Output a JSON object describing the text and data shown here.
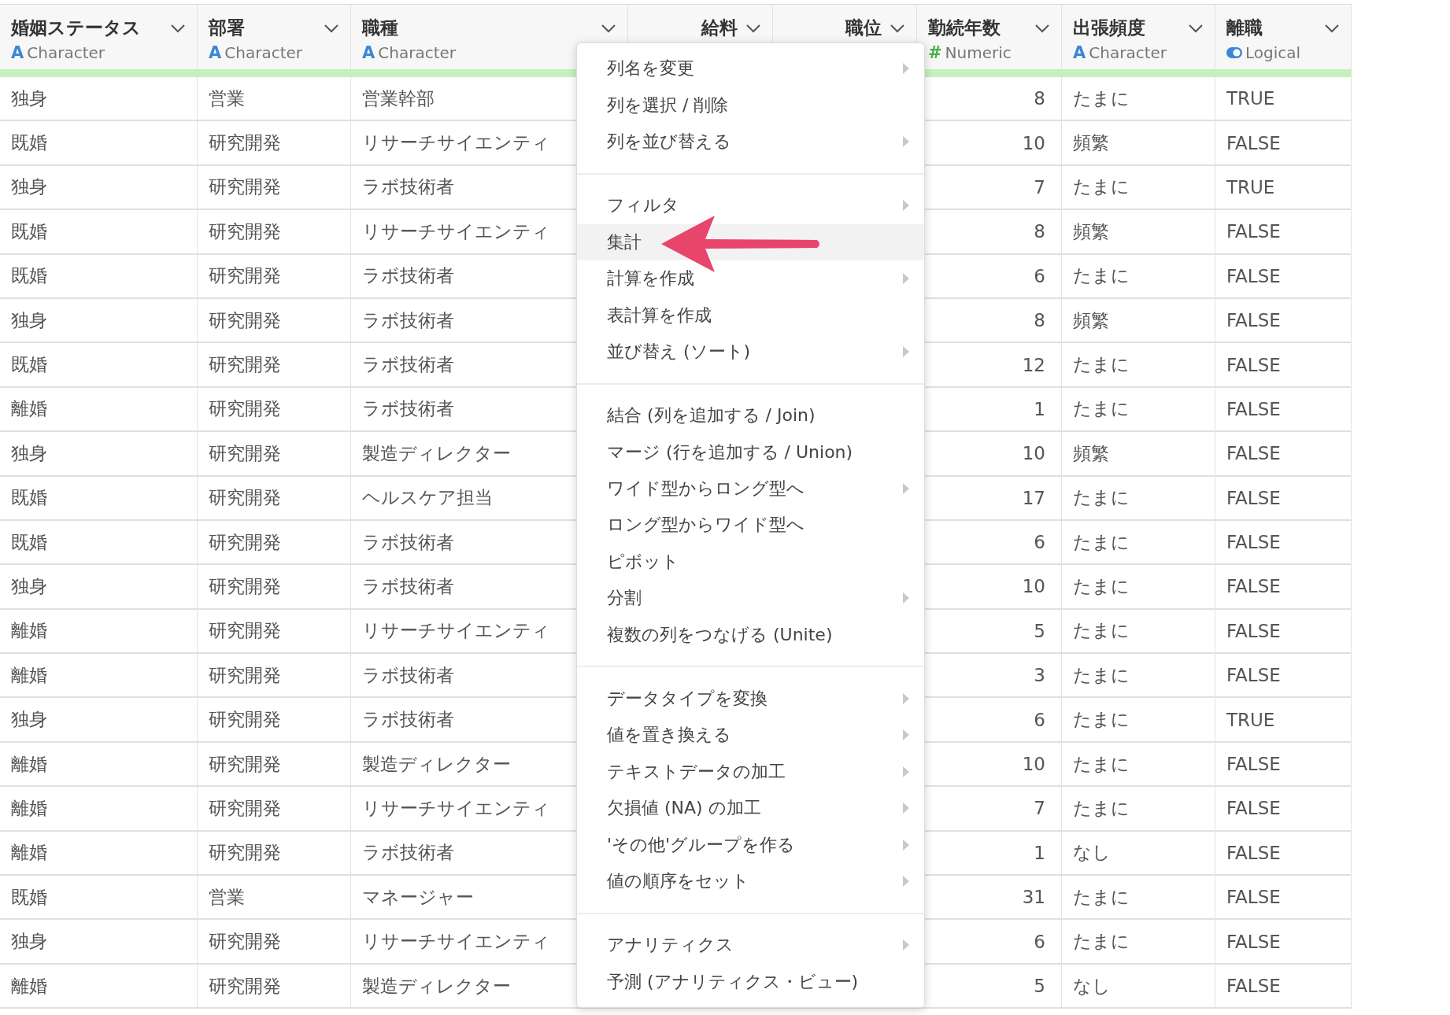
{
  "columns": [
    {
      "title": "婚姻ステータス",
      "kind": "character",
      "type_icon": "A",
      "type": "Character"
    },
    {
      "title": "部署",
      "kind": "character",
      "type_icon": "A",
      "type": "Character"
    },
    {
      "title": "職種",
      "kind": "character",
      "type_icon": "A",
      "type": "Character"
    },
    {
      "title": "給料",
      "kind": "covered"
    },
    {
      "title": "職位",
      "kind": "covered"
    },
    {
      "title": "勤続年数",
      "kind": "numeric",
      "type_icon": "#",
      "type": "Numeric"
    },
    {
      "title": "出張頻度",
      "kind": "character",
      "type_icon": "A",
      "type": "Character"
    },
    {
      "title": "離職",
      "kind": "logical",
      "type": "Logical"
    }
  ],
  "rows": [
    {
      "marital": "独身",
      "dept": "営業",
      "job": "営業幹部",
      "years": "8",
      "travel": "たまに",
      "attrition": "TRUE"
    },
    {
      "marital": "既婚",
      "dept": "研究開発",
      "job": "リサーチサイエンティ",
      "years": "10",
      "travel": "頻繁",
      "attrition": "FALSE"
    },
    {
      "marital": "独身",
      "dept": "研究開発",
      "job": "ラボ技術者",
      "years": "7",
      "travel": "たまに",
      "attrition": "TRUE"
    },
    {
      "marital": "既婚",
      "dept": "研究開発",
      "job": "リサーチサイエンティ",
      "years": "8",
      "travel": "頻繁",
      "attrition": "FALSE"
    },
    {
      "marital": "既婚",
      "dept": "研究開発",
      "job": "ラボ技術者",
      "years": "6",
      "travel": "たまに",
      "attrition": "FALSE"
    },
    {
      "marital": "独身",
      "dept": "研究開発",
      "job": "ラボ技術者",
      "years": "8",
      "travel": "頻繁",
      "attrition": "FALSE"
    },
    {
      "marital": "既婚",
      "dept": "研究開発",
      "job": "ラボ技術者",
      "years": "12",
      "travel": "たまに",
      "attrition": "FALSE"
    },
    {
      "marital": "離婚",
      "dept": "研究開発",
      "job": "ラボ技術者",
      "years": "1",
      "travel": "たまに",
      "attrition": "FALSE"
    },
    {
      "marital": "独身",
      "dept": "研究開発",
      "job": "製造ディレクター",
      "years": "10",
      "travel": "頻繁",
      "attrition": "FALSE"
    },
    {
      "marital": "既婚",
      "dept": "研究開発",
      "job": "ヘルスケア担当",
      "years": "17",
      "travel": "たまに",
      "attrition": "FALSE"
    },
    {
      "marital": "既婚",
      "dept": "研究開発",
      "job": "ラボ技術者",
      "years": "6",
      "travel": "たまに",
      "attrition": "FALSE"
    },
    {
      "marital": "独身",
      "dept": "研究開発",
      "job": "ラボ技術者",
      "years": "10",
      "travel": "たまに",
      "attrition": "FALSE"
    },
    {
      "marital": "離婚",
      "dept": "研究開発",
      "job": "リサーチサイエンティ",
      "years": "5",
      "travel": "たまに",
      "attrition": "FALSE"
    },
    {
      "marital": "離婚",
      "dept": "研究開発",
      "job": "ラボ技術者",
      "years": "3",
      "travel": "たまに",
      "attrition": "FALSE"
    },
    {
      "marital": "独身",
      "dept": "研究開発",
      "job": "ラボ技術者",
      "years": "6",
      "travel": "たまに",
      "attrition": "TRUE"
    },
    {
      "marital": "離婚",
      "dept": "研究開発",
      "job": "製造ディレクター",
      "years": "10",
      "travel": "たまに",
      "attrition": "FALSE"
    },
    {
      "marital": "離婚",
      "dept": "研究開発",
      "job": "リサーチサイエンティ",
      "years": "7",
      "travel": "たまに",
      "attrition": "FALSE"
    },
    {
      "marital": "離婚",
      "dept": "研究開発",
      "job": "ラボ技術者",
      "years": "1",
      "travel": "なし",
      "attrition": "FALSE"
    },
    {
      "marital": "既婚",
      "dept": "営業",
      "job": "マネージャー",
      "years": "31",
      "travel": "たまに",
      "attrition": "FALSE"
    },
    {
      "marital": "独身",
      "dept": "研究開発",
      "job": "リサーチサイエンティ",
      "years": "6",
      "travel": "たまに",
      "attrition": "FALSE"
    },
    {
      "marital": "離婚",
      "dept": "研究開発",
      "job": "製造ディレクター",
      "years": "5",
      "travel": "なし",
      "attrition": "FALSE"
    }
  ],
  "menu": {
    "groups": [
      [
        {
          "label": "列名を変更",
          "submenu": true,
          "selected": false
        },
        {
          "label": "列を選択 / 削除",
          "submenu": false,
          "selected": false
        },
        {
          "label": "列を並び替える",
          "submenu": true,
          "selected": false
        }
      ],
      [
        {
          "label": "フィルタ",
          "submenu": true,
          "selected": false
        },
        {
          "label": "集計",
          "submenu": false,
          "selected": true
        },
        {
          "label": "計算を作成",
          "submenu": true,
          "selected": false
        },
        {
          "label": "表計算を作成",
          "submenu": false,
          "selected": false
        },
        {
          "label": "並び替え (ソート)",
          "submenu": true,
          "selected": false
        }
      ],
      [
        {
          "label": "結合 (列を追加する / Join)",
          "submenu": false,
          "selected": false
        },
        {
          "label": "マージ (行を追加する / Union)",
          "submenu": false,
          "selected": false
        },
        {
          "label": "ワイド型からロング型へ",
          "submenu": true,
          "selected": false
        },
        {
          "label": "ロング型からワイド型へ",
          "submenu": false,
          "selected": false
        },
        {
          "label": "ピボット",
          "submenu": false,
          "selected": false
        },
        {
          "label": "分割",
          "submenu": true,
          "selected": false
        },
        {
          "label": "複数の列をつなげる (Unite)",
          "submenu": false,
          "selected": false
        }
      ],
      [
        {
          "label": "データタイプを変換",
          "submenu": true,
          "selected": false
        },
        {
          "label": "値を置き換える",
          "submenu": true,
          "selected": false
        },
        {
          "label": "テキストデータの加工",
          "submenu": true,
          "selected": false
        },
        {
          "label": "欠損値 (NA) の加工",
          "submenu": true,
          "selected": false
        },
        {
          "label": "'その他'グループを作る",
          "submenu": true,
          "selected": false
        },
        {
          "label": "値の順序をセット",
          "submenu": true,
          "selected": false
        }
      ],
      [
        {
          "label": "アナリティクス",
          "submenu": true,
          "selected": false
        },
        {
          "label": "予測 (アナリティクス・ビュー)",
          "submenu": false,
          "selected": false
        }
      ]
    ]
  }
}
